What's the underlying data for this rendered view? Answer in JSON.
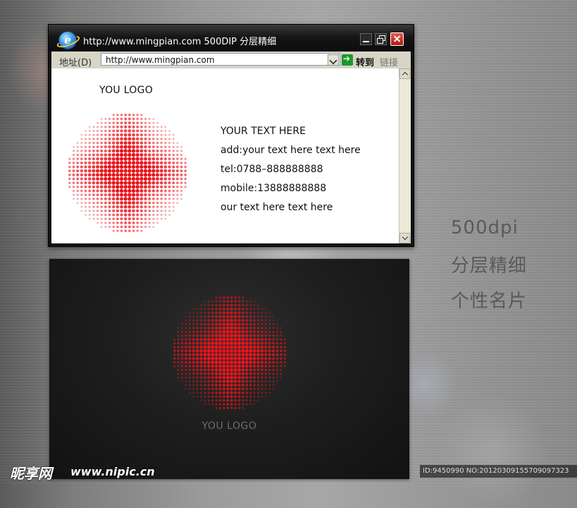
{
  "window": {
    "title": "http://www.mingpian.com 500DIP 分层精细",
    "icon": "ie-icon"
  },
  "addressbar": {
    "label": "地址(D)",
    "url": "http://www.mingpian.com",
    "go_label": "转到",
    "links_label": "链接"
  },
  "card_front": {
    "logo_text": "YOU LOGO",
    "headline": "YOUR TEXT HERE",
    "address": "add:your text here text here",
    "tel": "tel:0788–888888888",
    "mobile": "mobile:13888888888",
    "tagline": "our text here text here",
    "accent_color": "#e8141c"
  },
  "card_back": {
    "logo_text": "YOU LOGO",
    "background_color": "#1a1a1a"
  },
  "side_caption": {
    "line1": "500dpi",
    "line2": "分层精细",
    "line3": "个性名片"
  },
  "watermark": {
    "brand": "昵享网",
    "url": "www.nipic.cn",
    "id_text": "ID:9450990 NO:20120309155709097323"
  }
}
